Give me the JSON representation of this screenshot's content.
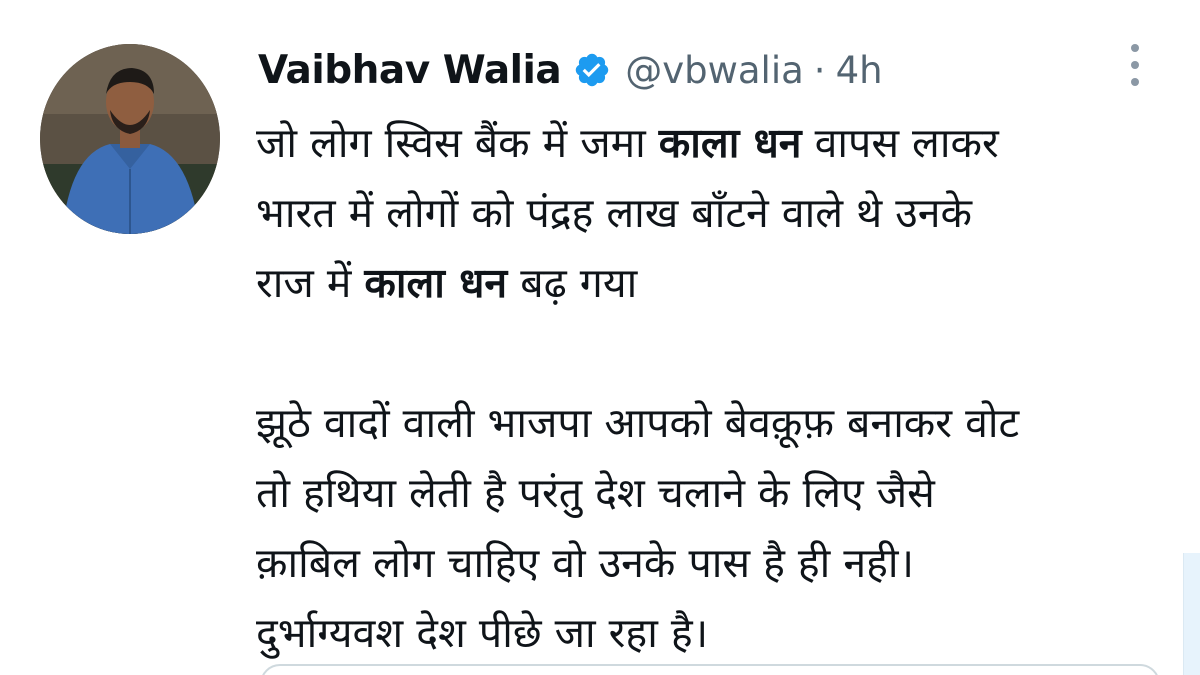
{
  "author": {
    "display_name": "Vaibhav Walia",
    "handle": "@vbwalia",
    "separator": "·",
    "time": "4h",
    "verified": true,
    "avatar_icon": "profile-photo"
  },
  "tweet": {
    "para1": {
      "line1_a": "जो लोग स्विस बैंक में जमा ",
      "line1_bold": "काला धन",
      "line1_b": " वापस लाकर",
      "line2": "भारत में लोगों को पंद्रह लाख बाँटने वाले थे उनके",
      "line3_a": "राज में ",
      "line3_bold": "काला धन",
      "line3_b": " बढ़ गया"
    },
    "para2": {
      "line1": "झूठे वादों वाली भाजपा आपको बेवक़ूफ़ बनाकर वोट",
      "line2": "तो हथिया लेती है परंतु देश चलाने के लिए जैसे",
      "line3": "क़ाबिल लोग चाहिए वो उनके पास है ही नही।",
      "line4": "दुर्भाग्यवश देश पीछे जा रहा है।"
    }
  },
  "icons": {
    "verified": "verified-badge-icon",
    "more": "more-vertical-icon"
  },
  "colors": {
    "text": "#0f1419",
    "secondary": "#536471",
    "verified_blue": "#1d9bf0"
  }
}
